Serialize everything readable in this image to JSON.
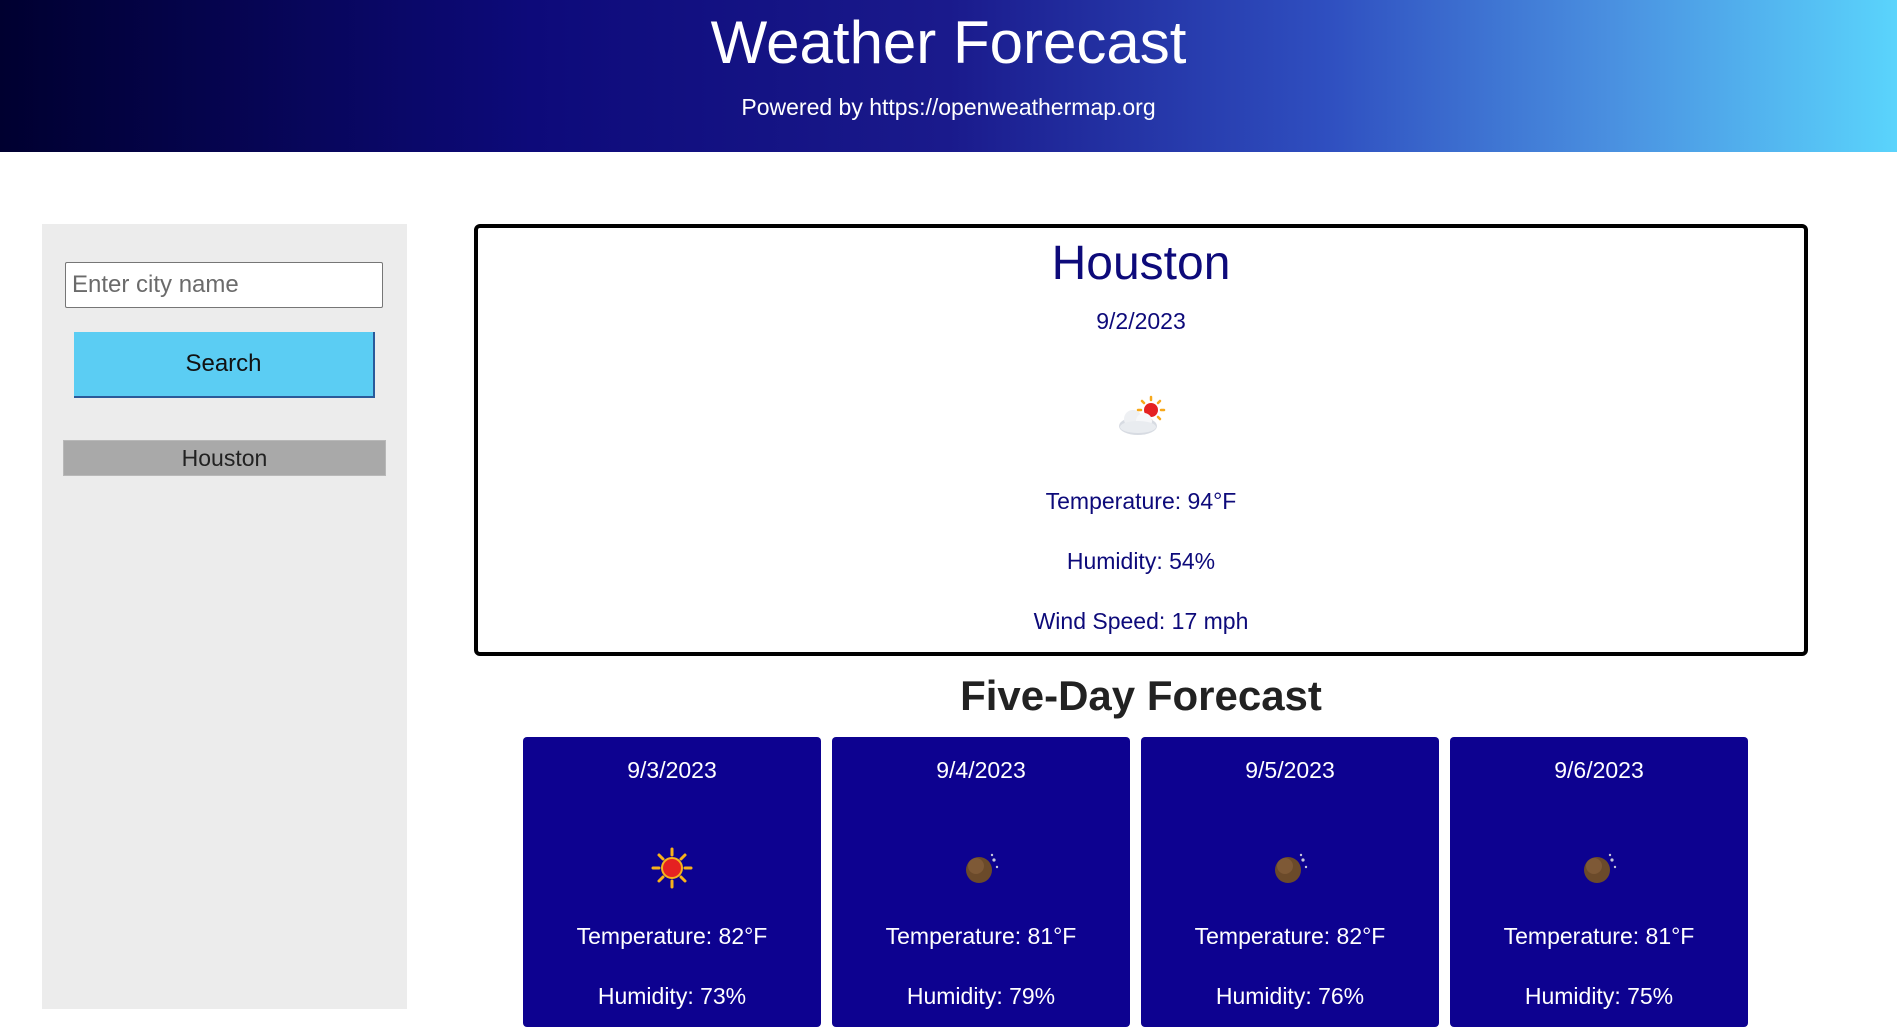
{
  "header": {
    "title": "Weather Forecast",
    "subtitle": "Powered by https://openweathermap.org"
  },
  "sidebar": {
    "search_placeholder": "Enter city name",
    "search_value": "",
    "search_button_label": "Search",
    "history": [
      "Houston"
    ]
  },
  "current": {
    "city": "Houston",
    "date": "9/2/2023",
    "icon": "few-clouds-day-icon",
    "temperature": "Temperature: 94°F",
    "humidity": "Humidity: 54%",
    "wind": "Wind Speed: 17 mph"
  },
  "forecast": {
    "title": "Five-Day Forecast",
    "days": [
      {
        "date": "9/3/2023",
        "icon": "clear-sky-icon",
        "temperature": "Temperature: 82°F",
        "humidity": "Humidity: 73%"
      },
      {
        "date": "9/4/2023",
        "icon": "clear-night-icon",
        "temperature": "Temperature: 81°F",
        "humidity": "Humidity: 79%"
      },
      {
        "date": "9/5/2023",
        "icon": "clear-night-icon",
        "temperature": "Temperature: 82°F",
        "humidity": "Humidity: 76%"
      },
      {
        "date": "9/6/2023",
        "icon": "clear-night-icon",
        "temperature": "Temperature: 81°F",
        "humidity": "Humidity: 75%"
      }
    ]
  },
  "colors": {
    "header_start": "#000030",
    "header_end": "#5ad4fc",
    "accent_button": "#5bcdf3",
    "card_bg": "#0d0290",
    "text_navy": "#0d0a7a",
    "history_button": "#a9a9a9"
  }
}
